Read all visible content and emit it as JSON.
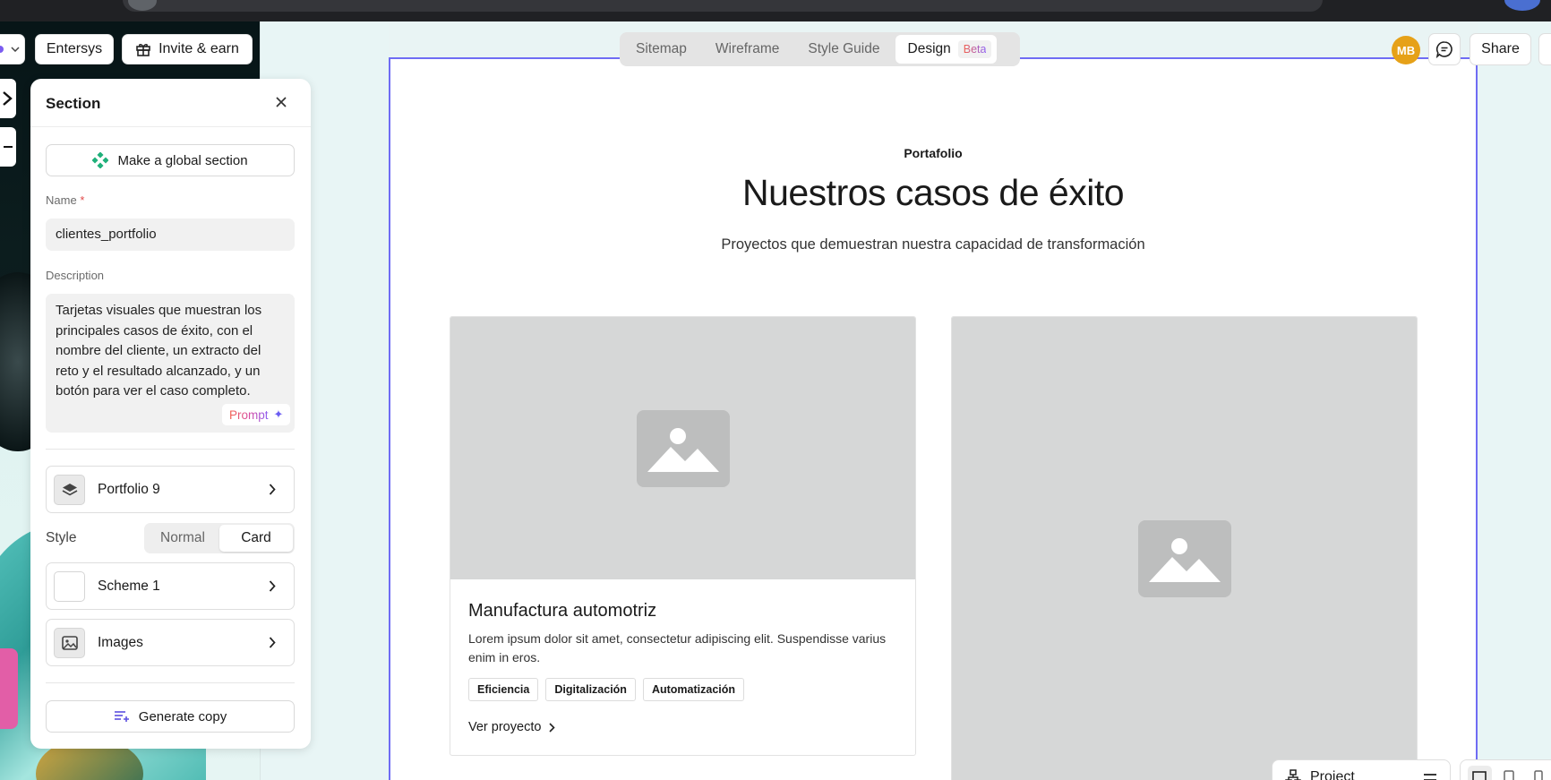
{
  "toolbar": {
    "workspace_label": "Entersys",
    "invite_label": "Invite & earn"
  },
  "panel": {
    "title": "Section",
    "global_section_label": "Make a global section",
    "name_label": "Name",
    "name_required": "*",
    "name_value": "clientes_portfolio",
    "description_label": "Description",
    "description_value": "Tarjetas visuales que muestran los principales casos de éxito, con el nombre del cliente, un extracto del reto y el resultado alcanzado, y un botón para ver el caso completo.",
    "prompt_label": "Prompt",
    "layout_label": "Portfolio 9",
    "style_label": "Style",
    "style_options": [
      "Normal",
      "Card"
    ],
    "style_selected": "Card",
    "scheme_label": "Scheme 1",
    "images_label": "Images",
    "generate_label": "Generate copy"
  },
  "view_tabs": {
    "sitemap": "Sitemap",
    "wireframe": "Wireframe",
    "style_guide": "Style Guide",
    "design": "Design",
    "design_badge": "Beta",
    "active": "Design"
  },
  "header_right": {
    "avatar_initials": "MB",
    "share_label": "Share"
  },
  "page": {
    "eyebrow": "Portafolio",
    "headline": "Nuestros casos de éxito",
    "subhead": "Proyectos que demuestran nuestra capacidad de transformación",
    "cards": [
      {
        "title": "Manufactura automotriz",
        "text": "Lorem ipsum dolor sit amet, consectetur adipiscing elit. Suspendisse varius enim in eros.",
        "tags": [
          "Eficiencia",
          "Digitalización",
          "Automatización"
        ],
        "link": "Ver proyecto"
      }
    ]
  },
  "bottom_bar": {
    "project_label": "Project"
  },
  "colors": {
    "accent": "#6f6cf4",
    "avatar": "#e6a118",
    "global_icon": "#1fb07a"
  }
}
